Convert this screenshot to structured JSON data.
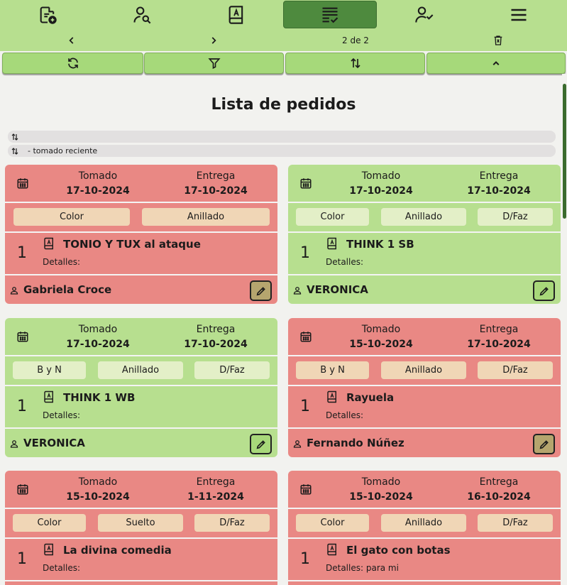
{
  "nav": {
    "items": [
      {
        "icon": "new-order-icon"
      },
      {
        "icon": "search-client-icon"
      },
      {
        "icon": "book-icon"
      },
      {
        "icon": "order-list-icon",
        "active": true
      },
      {
        "icon": "user-check-icon"
      },
      {
        "icon": "menu-icon"
      }
    ]
  },
  "pager": {
    "prev_icon": "chevron-left-icon",
    "next_icon": "chevron-right-icon",
    "page_label": "2 de 2",
    "delete_icon": "trash-icon"
  },
  "toolbar": {
    "refresh_icon": "refresh-icon",
    "filter_icon": "filter-icon",
    "sort_icon": "sort-icon",
    "collapse_icon": "chevron-up-icon"
  },
  "page": {
    "title": "Lista de pedidos"
  },
  "sort": {
    "line1": "",
    "line2": "- tomado reciente"
  },
  "labels": {
    "tomado": "Tomado",
    "entrega": "Entrega"
  },
  "colors": {
    "red_card": "#e98884",
    "green_card": "#b7df8f",
    "accent": "#4e8a3e"
  },
  "orders": [
    {
      "status": "red",
      "tomado": "17-10-2024",
      "entrega": "17-10-2024",
      "tags": [
        "Color",
        "Anillado"
      ],
      "qty": "1",
      "title": "TONIO Y TUX al ataque",
      "details": "Detalles:",
      "client": "Gabriela Croce"
    },
    {
      "status": "green",
      "tomado": "17-10-2024",
      "entrega": "17-10-2024",
      "tags": [
        "Color",
        "Anillado",
        "D/Faz"
      ],
      "qty": "1",
      "title": "THINK 1 SB",
      "details": "Detalles:",
      "client": "VERONICA"
    },
    {
      "status": "green",
      "tomado": "17-10-2024",
      "entrega": "17-10-2024",
      "tags": [
        "B y N",
        "Anillado",
        "D/Faz"
      ],
      "qty": "1",
      "title": "THINK 1 WB",
      "details": "Detalles:",
      "client": "VERONICA"
    },
    {
      "status": "red",
      "tomado": "15-10-2024",
      "entrega": "17-10-2024",
      "tags": [
        "B y N",
        "Anillado",
        "D/Faz"
      ],
      "qty": "1",
      "title": "Rayuela",
      "details": "Detalles:",
      "client": "Fernando Núñez"
    },
    {
      "status": "red",
      "tomado": "15-10-2024",
      "entrega": "1-11-2024",
      "tags": [
        "Color",
        "Suelto",
        "D/Faz"
      ],
      "qty": "1",
      "title": "La divina comedia",
      "details": "Detalles:",
      "client": ""
    },
    {
      "status": "red",
      "tomado": "15-10-2024",
      "entrega": "16-10-2024",
      "tags": [
        "Color",
        "Anillado",
        "D/Faz"
      ],
      "qty": "1",
      "title": "El gato con botas",
      "details": "Detalles: para mi",
      "client": ""
    }
  ]
}
